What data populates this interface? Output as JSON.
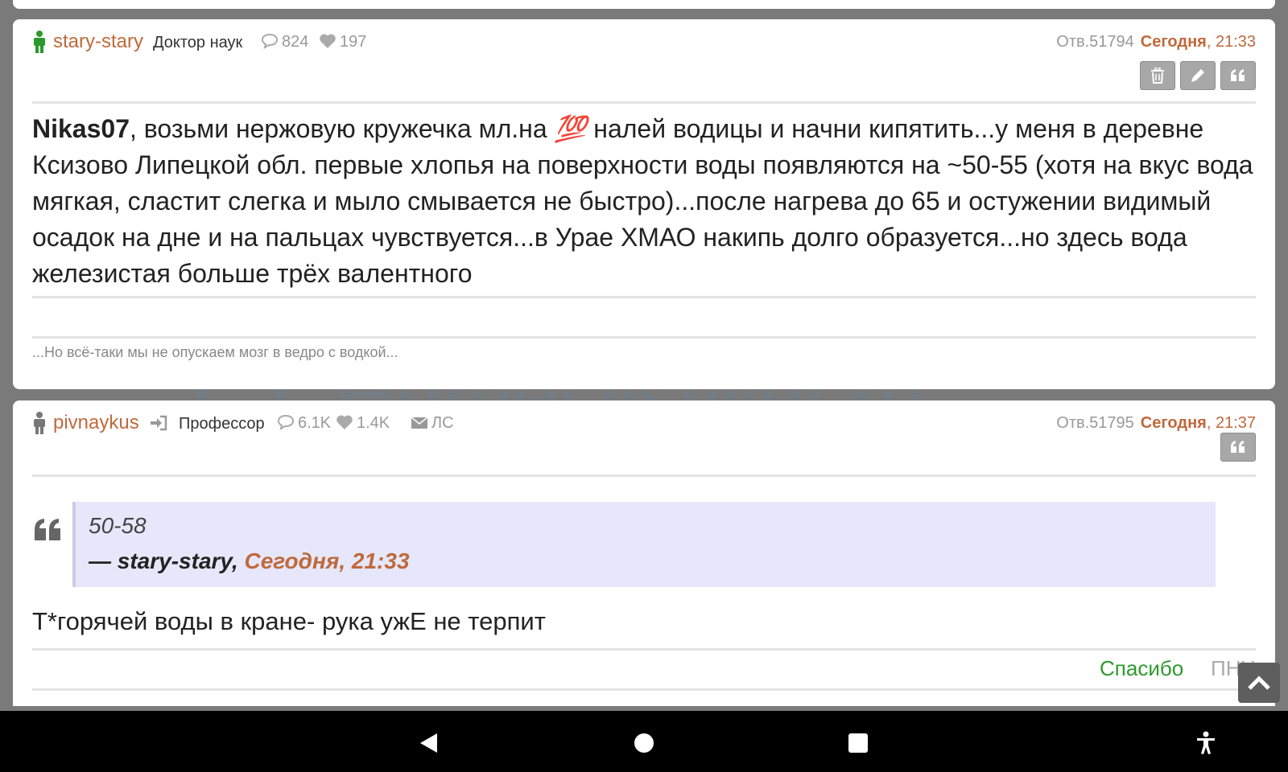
{
  "post1": {
    "username": "stary-stary",
    "rank": "Доктор наук",
    "comments": "824",
    "likes": "197",
    "post_number": "Отв.51794",
    "time_day": "Сегодня",
    "time_clock": ", 21:33",
    "mention": "Nikas07",
    "body_part1": ", возьми нержовую кружечка мл.на ",
    "emoji": "💯",
    "body_part2": " налей водицы и начни кипятить...у меня в деревне Ксизово Липецкой обл. первые хлопья на поверхности воды появляются на ~50-55 (хотя на вкус вода мягкая, сластит слегка и мыло смывается не быстро)...после нагрева до 65 и остужении видимый осадок на дне и на пальцах чувствуется...в Урае ХМАО накипь долго образуется...но здесь вода железистая больше трёх валентного",
    "signature": "...Но всё-таки мы не опускаем мозг в ведро с водкой..."
  },
  "post2": {
    "username": "pivnaykus",
    "rank": "Профессор",
    "comments": "6.1K",
    "likes": "1.4K",
    "pm_label": "ЛС",
    "post_number": "Отв.51795",
    "time_day": "Сегодня",
    "time_clock": ", 21:37",
    "quote_text": "50-58",
    "quote_author": "— stary-stary, ",
    "quote_time": "Сегодня, 21:33",
    "body": "Т*горячей воды в кране- рука ужЕ не терпит",
    "thanks_label": "Спасибо",
    "pnv_label": "ПНУ"
  },
  "watermark": "HomeDistiller.ru",
  "colors": {
    "username": "#c0693c",
    "online_icon": "#2a9a2a",
    "offline_icon": "#777777",
    "thanks": "#2e9a2e",
    "quote_bg": "#e6e7fa"
  },
  "icons": [
    "trash-icon",
    "pencil-icon",
    "quote-icon",
    "comments-icon",
    "heart-icon",
    "envelope-icon",
    "sign-in-icon",
    "chevron-up-icon",
    "back-icon",
    "home-icon",
    "recents-icon",
    "accessibility-icon"
  ]
}
